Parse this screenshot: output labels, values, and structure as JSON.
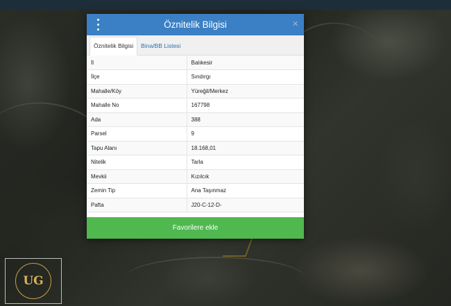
{
  "dialog": {
    "title": "Öznitelik Bilgisi",
    "close_label": "×",
    "tabs": [
      {
        "label": "Öznitelik Bilgisi",
        "active": true
      },
      {
        "label": "Bina/BB Listesi",
        "active": false
      }
    ],
    "rows": [
      {
        "key": "İl",
        "value": "Balıkesir"
      },
      {
        "key": "İlçe",
        "value": "Sındırgı"
      },
      {
        "key": "Mahalle/Köy",
        "value": "Yüreğil/Merkez"
      },
      {
        "key": "Mahalle No",
        "value": "167798"
      },
      {
        "key": "Ada",
        "value": "388"
      },
      {
        "key": "Parsel",
        "value": "9"
      },
      {
        "key": "Tapu Alanı",
        "value": "18.168,01"
      },
      {
        "key": "Nitelik",
        "value": "Tarla"
      },
      {
        "key": "Mevkii",
        "value": "Kızılcık"
      },
      {
        "key": "Zemin Tip",
        "value": "Ana Taşınmaz"
      },
      {
        "key": "Pafta",
        "value": "J20-C-12-D-"
      }
    ],
    "favorite_button": "Favorilere ekle"
  },
  "logo": {
    "initials": "UG"
  },
  "colors": {
    "header": "#3b7fc4",
    "button": "#4fb84f"
  }
}
